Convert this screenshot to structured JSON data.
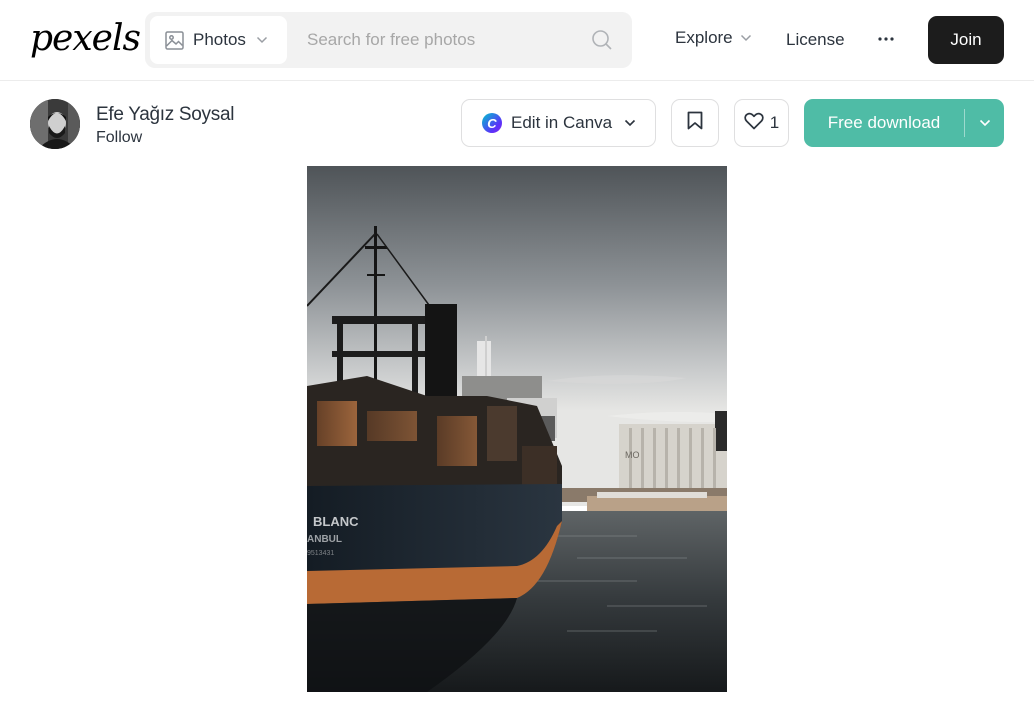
{
  "brand": {
    "logo_text": "pexels"
  },
  "search": {
    "media_type": "Photos",
    "placeholder": "Search for free photos"
  },
  "nav": {
    "explore_label": "Explore",
    "license_label": "License",
    "more_label": "···",
    "join_label": "Join"
  },
  "author": {
    "name": "Efe Yağız Soysal",
    "follow_label": "Follow"
  },
  "actions": {
    "canva_label": "Edit in Canva",
    "canva_logo_letter": "C",
    "like_count": "1",
    "download_label": "Free download"
  },
  "photo": {
    "ship_name": "BLANC",
    "ship_port": "ANBUL",
    "ship_number": "9513431",
    "silo_text": "MO"
  },
  "colors": {
    "download_green": "#05a081",
    "join_black": "#1c1c1c",
    "text_dark": "#2c343e",
    "placeholder_grey": "#a7a7a7"
  },
  "icons": [
    "image-icon",
    "chevron-down-icon",
    "search-icon",
    "more-icon",
    "canva-logo-icon",
    "bookmark-icon",
    "heart-icon"
  ]
}
